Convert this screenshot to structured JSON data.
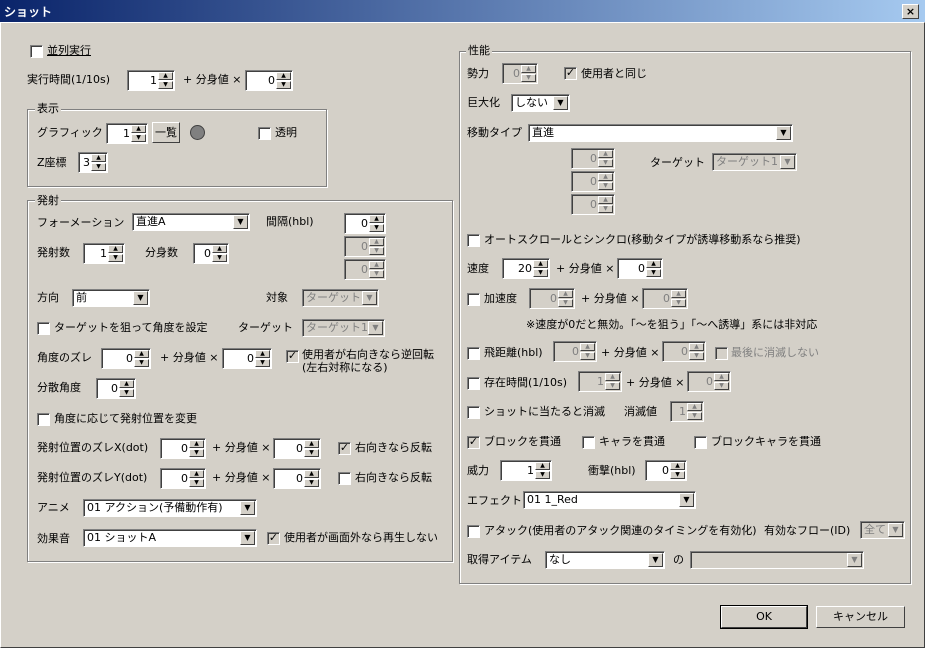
{
  "title": "ショット",
  "close": "×",
  "parallel": "並列実行",
  "exec_time": {
    "label": "実行時間(1/10s)",
    "value": "1",
    "plus": "+ 分身値 ×",
    "mult": "0"
  },
  "display": {
    "title": "表示",
    "graphic_label": "グラフィック",
    "graphic": "1",
    "list_btn": "一覧",
    "transparent": "透明",
    "z_label": "Z座標",
    "z": "3"
  },
  "fire": {
    "title": "発射",
    "formation_label": "フォーメーション",
    "formation": "直進A",
    "interval_label": "間隔(hbl)",
    "interval": "0",
    "interval2": "0",
    "interval3": "0",
    "count_label": "発射数",
    "count": "1",
    "split_label": "分身数",
    "split": "0",
    "dir_label": "方向",
    "dir": "前",
    "target_label": "対象",
    "target": "ターゲット",
    "aim": "ターゲットを狙って角度を設定",
    "aim_target_label": "ターゲット",
    "aim_target": "ターゲット1",
    "angle_label": "角度のズレ",
    "angle": "0",
    "plus": "+ 分身値 ×",
    "angle_mult": "0",
    "reverse": "使用者が右向きなら逆回転",
    "reverse_sub": "(左右対称になる)",
    "spread_label": "分散角度",
    "spread": "0",
    "change_pos": "角度に応じて発射位置を変更",
    "posx_label": "発射位置のズレX(dot)",
    "posx": "0",
    "posx_mult": "0",
    "flip_x": "右向きなら反転",
    "posy_label": "発射位置のズレY(dot)",
    "posy": "0",
    "posy_mult": "0",
    "flip_y": "右向きなら反転",
    "anime_label": "アニメ",
    "anime": "01 アクション(予備動作有)",
    "se_label": "効果音",
    "se": "01 ショットA",
    "no_offscreen": "使用者が画面外なら再生しない"
  },
  "perf": {
    "title": "性能",
    "force_label": "勢力",
    "force": "0",
    "same_user": "使用者と同じ",
    "giant_label": "巨大化",
    "giant": "しない",
    "move_label": "移動タイプ",
    "move": "直進",
    "m1": "0",
    "m2": "0",
    "m3": "0",
    "mt_label": "ターゲット",
    "mt": "ターゲット1",
    "autoscroll": "オートスクロールとシンクロ(移動タイプが誘導移動系なら推奨)",
    "speed_label": "速度",
    "speed": "20",
    "plus": "+ 分身値 ×",
    "speed_mult": "0",
    "accel": "加速度",
    "accel_v": "0",
    "accel_mult": "0",
    "note": "※速度が0だと無効。「～を狙う」「～へ誘導」系には非対応",
    "range": "飛距離(hbl)",
    "range_v": "0",
    "range_mult": "0",
    "last_vanish": "最後に消滅しない",
    "life": "存在時間(1/10s)",
    "life_v": "1",
    "life_mult": "0",
    "shot_vanish": "ショットに当たると消滅",
    "vanish_label": "消滅値",
    "vanish_v": "1",
    "pierce_block": "ブロックを貫通",
    "pierce_chara": "キャラを貫通",
    "pierce_bchara": "ブロックキャラを貫通",
    "power_label": "威力",
    "power": "1",
    "impact_label": "衝撃(hbl)",
    "impact": "0",
    "effect_label": "エフェクト",
    "effect": "01 1_Red",
    "attack": "アタック(使用者のアタック関連のタイミングを有効化)",
    "flow_label": "有効なフロー(ID)",
    "flow": "全て",
    "item_label": "取得アイテム",
    "item": "なし",
    "of": "の",
    "item2": ""
  },
  "ok": "OK",
  "cancel": "キャンセル"
}
